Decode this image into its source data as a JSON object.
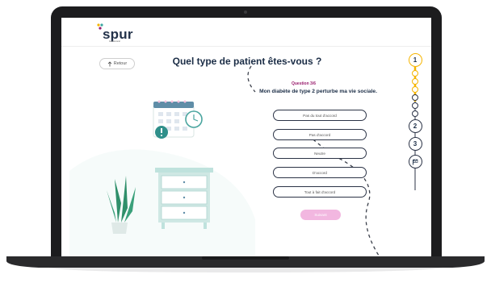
{
  "app": {
    "logo_text": "spur",
    "logo_sub": "behavioral"
  },
  "nav": {
    "back_label": "Retour",
    "back_icon": "arrow-up-icon"
  },
  "page": {
    "title": "Quel type de patient êtes-vous ?",
    "question_number": "Question 3/6",
    "question_text": "Mon diabète de type 2 perturbe ma vie sociale."
  },
  "options": [
    "Pas du tout d'accord",
    "Pas d'accord",
    "Neutre",
    "D'accord",
    "Tout à fait d'accord"
  ],
  "submit_label": "Suivant",
  "progress": {
    "steps": [
      "1",
      "2",
      "3"
    ],
    "finish_icon": "flag-icon",
    "current_question": 3,
    "total_questions": 6
  },
  "colors": {
    "accent": "#9a1e6e",
    "navy": "#1b2d46",
    "progress_yellow": "#f5b400",
    "submit_disabled": "#f2b7e0",
    "illustration_teal": "#cfe8e4"
  }
}
